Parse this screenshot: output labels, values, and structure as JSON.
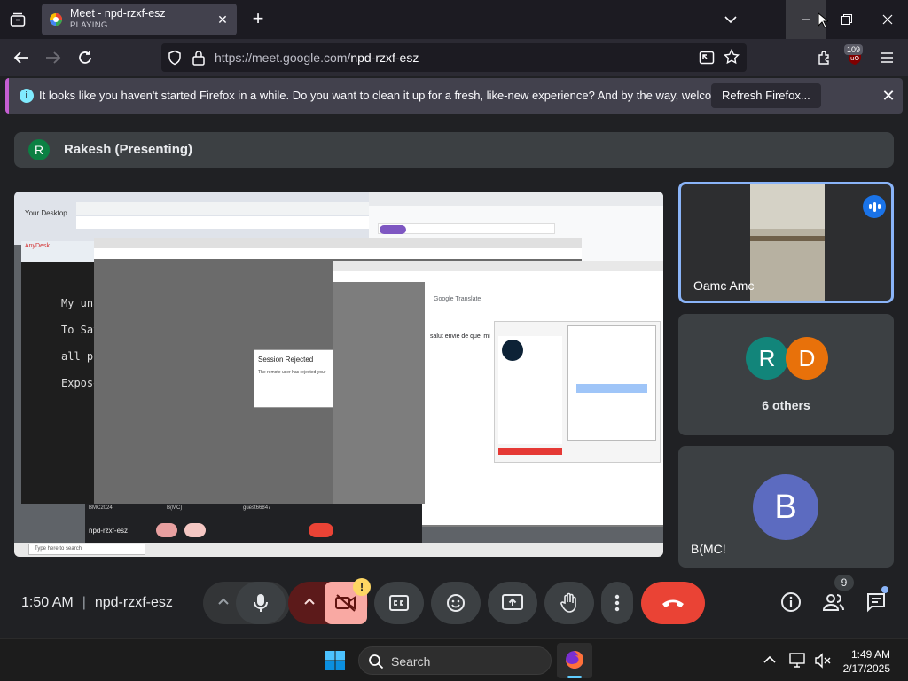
{
  "browser": {
    "tab": {
      "title": "Meet - npd-rzxf-esz",
      "status": "PLAYING"
    },
    "url_prefix": "https://meet.google.com/",
    "url_path": "npd-rzxf-esz",
    "extension_badge": "109"
  },
  "notification": {
    "message": "It looks like you haven't started Firefox in a while. Do you want to clean it up for a fresh, like-new experience? And by the way, welcome back!",
    "button": "Refresh Firefox..."
  },
  "presenter": {
    "initial": "R",
    "name": "Rakesh (Presenting)"
  },
  "shared_screen": {
    "desktop_title": "Your Desktop",
    "dialog_title": "Session Rejected",
    "dialog_text": "The remote user has rejected your",
    "editor_lines": [
      "My una",
      "To Save",
      "all pic",
      "Expose"
    ],
    "remote_meet_code": "npd-rzxf-esz",
    "remote_search": "Type here to search",
    "anydesk_label": "AnyDesk",
    "google_translate": "Google Translate",
    "translated_text": "salut envie de quel mi",
    "tile_names": [
      "BMC2024",
      "B(MC)",
      "guest66847"
    ]
  },
  "tiles": [
    {
      "name": "Oamc Amc"
    },
    {
      "initials": [
        "R",
        "D"
      ],
      "label": "6 others"
    },
    {
      "initial": "B",
      "name": "B(MC!"
    }
  ],
  "meeting": {
    "time": "1:50 AM",
    "code": "npd-rzxf-esz",
    "people_count": "9",
    "warning": "!"
  },
  "taskbar": {
    "search_label": "Search",
    "time": "1:49 AM",
    "date": "2/17/2025"
  },
  "colors": {
    "presenter_avatar": "#0b8043",
    "avatar_r": "#12857a",
    "avatar_d": "#e8710a",
    "avatar_b": "#5c6bc0",
    "end_call": "#ea4335",
    "active_tile_border": "#8ab4f8"
  }
}
